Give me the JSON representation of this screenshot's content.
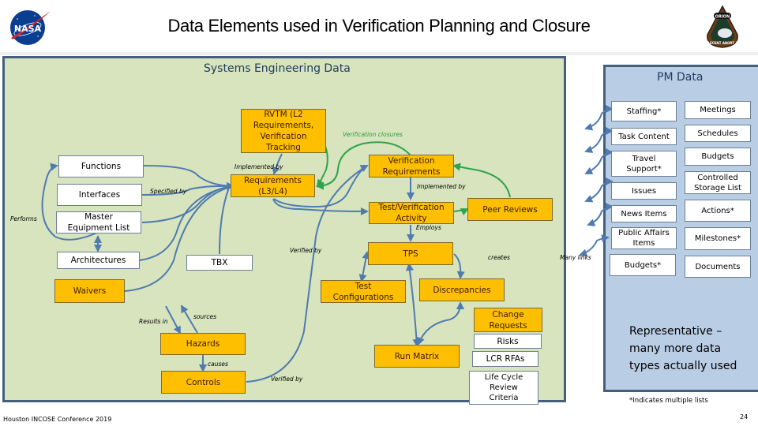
{
  "slide": {
    "title": "Data Elements used in Verification Planning and Closure",
    "footer": "Houston INCOSE Conference 2019",
    "page_number": "24",
    "logos": {
      "left": "nasa-logo",
      "right": "orion-ascent-abort-2-patch"
    }
  },
  "se_panel": {
    "title": "Systems Engineering Data",
    "boxes": {
      "rvtm": "RVTM (L2 Requirements, Verification Tracking",
      "functions": "Functions",
      "interfaces": "Interfaces",
      "mel": "Master Equipment List",
      "architectures": "Architectures",
      "waivers": "Waivers",
      "requirements": "Requirements (L3/L4)",
      "tbx": "TBX",
      "verification_requirements": "Verification Requirements",
      "test_verification_activity": "Test/Verification Activity",
      "peer_reviews": "Peer Reviews",
      "tps": "TPS",
      "test_configurations": "Test Configurations",
      "discrepancies": "Discrepancies",
      "change_requests": "Change Requests",
      "risks": "Risks",
      "lcr_rfas": "LCR RFAs",
      "life_cycle_review_criteria": "Life Cycle Review Criteria",
      "hazards": "Hazards",
      "controls": "Controls",
      "run_matrix": "Run Matrix"
    },
    "labels": {
      "verification_closures": "Verification closures",
      "implemented_by_1": "Implemented by",
      "implemented_by_2": "Implemented by",
      "specified_by": "Specified by",
      "performs": "Performs",
      "employs": "Employs",
      "verified_by_1": "Verified by",
      "verified_by_2": "Verified by",
      "creates": "creates",
      "results_in": "Results in",
      "sources": "sources",
      "causes": "causes",
      "many_links": "Many links"
    }
  },
  "pm_panel": {
    "title": "PM Data",
    "left_items": [
      "Staffing*",
      "Task Content",
      "Travel Support*",
      "Issues",
      "News Items",
      "Public Affairs Items",
      "Budgets*"
    ],
    "right_items": [
      "Meetings",
      "Schedules",
      "Budgets",
      "Controlled Storage List",
      "Actions*",
      "Milestones*",
      "Documents"
    ],
    "note": "Representative – many more data types actually used",
    "footnote": "*Indicates multiple lists"
  },
  "colors": {
    "se_background": "#d7e4bd",
    "pm_background": "#b9cde5",
    "gold_box": "#fdbf00",
    "panel_border": "#44607e",
    "link_blue": "#4f7bb0",
    "link_green": "#2ea44a"
  }
}
